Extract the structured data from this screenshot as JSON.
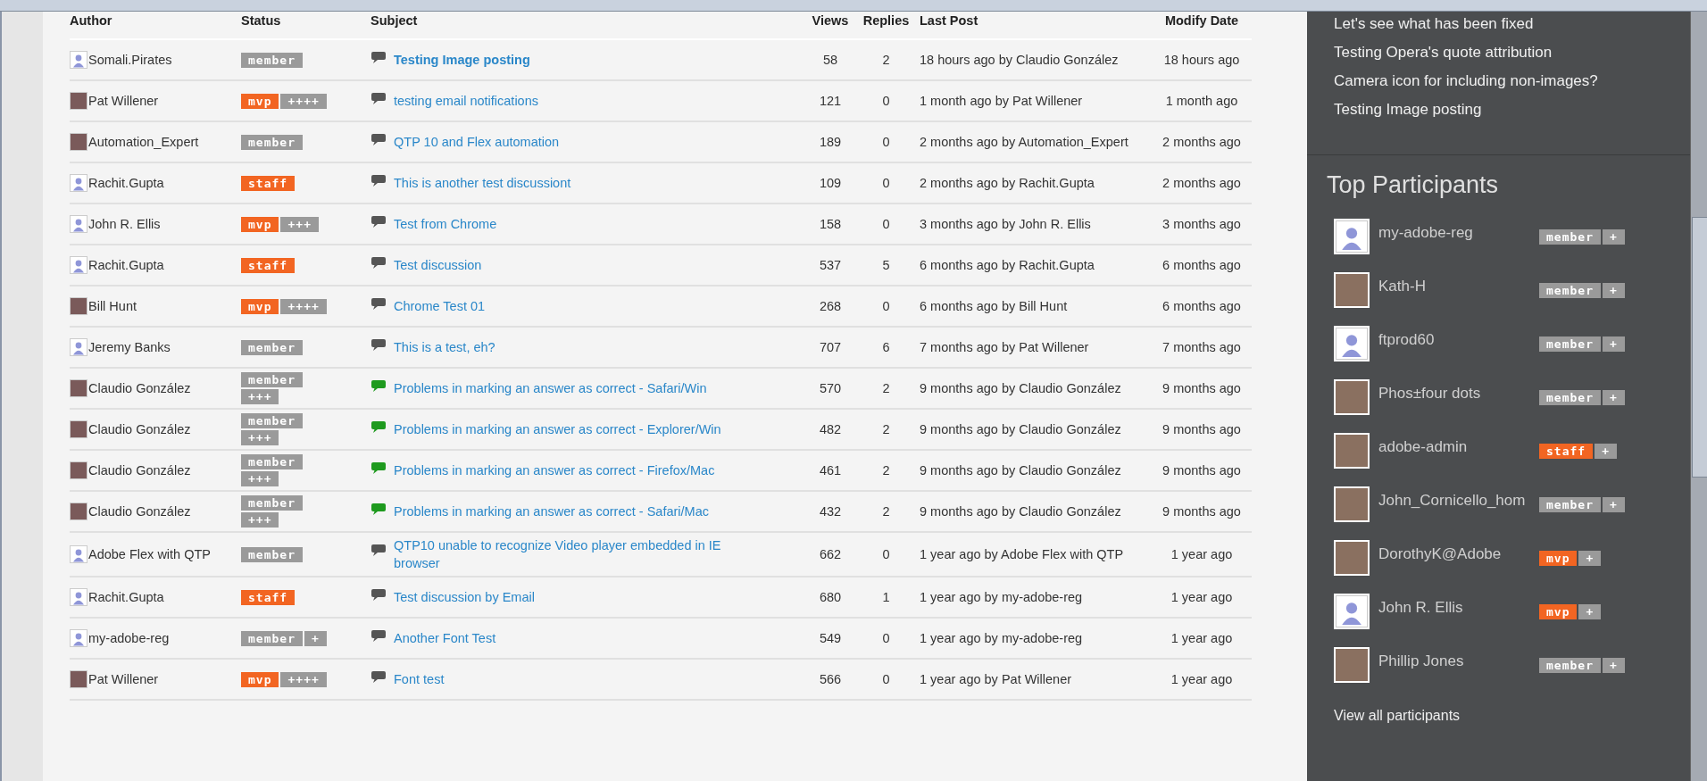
{
  "topics": {
    "columns": [
      "Author",
      "Status",
      "Subject",
      "Views",
      "Replies",
      "Last Post",
      "Modify Date"
    ],
    "rows": [
      {
        "author": "Somali.Pirates",
        "avatar": {
          "kind": "default"
        },
        "status": {
          "kind": "member",
          "label": "member"
        },
        "subject": "Testing Image posting",
        "unread": true,
        "answered": false,
        "views": "58",
        "replies": "2",
        "last_post": "18 hours ago by Claudio González",
        "modify_date": "18 hours ago"
      },
      {
        "author": "Pat Willener",
        "avatar": {
          "kind": "image"
        },
        "status": {
          "kind": "mvp",
          "label": "mvp",
          "plus": "++++"
        },
        "subject": "testing email notifications",
        "unread": false,
        "answered": false,
        "views": "121",
        "replies": "0",
        "last_post": "1 month ago by Pat Willener",
        "modify_date": "1 month ago"
      },
      {
        "author": "Automation_Expert",
        "avatar": {
          "kind": "image"
        },
        "status": {
          "kind": "member",
          "label": "member"
        },
        "subject": "QTP 10 and Flex automation",
        "unread": false,
        "answered": false,
        "views": "189",
        "replies": "0",
        "last_post": "2 months ago by Automation_Expert",
        "modify_date": "2 months ago"
      },
      {
        "author": "Rachit.Gupta",
        "avatar": {
          "kind": "default"
        },
        "status": {
          "kind": "staff",
          "label": "staff"
        },
        "subject": "This is another test discussiont",
        "unread": false,
        "answered": false,
        "views": "109",
        "replies": "0",
        "last_post": "2 months ago by Rachit.Gupta",
        "modify_date": "2 months ago"
      },
      {
        "author": "John R. Ellis",
        "avatar": {
          "kind": "default"
        },
        "status": {
          "kind": "mvp",
          "label": "mvp",
          "plus": "+++"
        },
        "subject": "Test from Chrome",
        "unread": false,
        "answered": false,
        "views": "158",
        "replies": "0",
        "last_post": "3 months ago by John R. Ellis",
        "modify_date": "3 months ago"
      },
      {
        "author": "Rachit.Gupta",
        "avatar": {
          "kind": "default"
        },
        "status": {
          "kind": "staff",
          "label": "staff"
        },
        "subject": "Test discussion",
        "unread": false,
        "answered": false,
        "views": "537",
        "replies": "5",
        "last_post": "6 months ago by Rachit.Gupta",
        "modify_date": "6 months ago"
      },
      {
        "author": "Bill Hunt",
        "avatar": {
          "kind": "image"
        },
        "status": {
          "kind": "mvp",
          "label": "mvp",
          "plus": "++++"
        },
        "subject": "Chrome Test 01",
        "unread": false,
        "answered": false,
        "views": "268",
        "replies": "0",
        "last_post": "6 months ago by Bill Hunt",
        "modify_date": "6 months ago"
      },
      {
        "author": "Jeremy Banks",
        "avatar": {
          "kind": "default"
        },
        "status": {
          "kind": "member",
          "label": "member"
        },
        "subject": "This is a test, eh?",
        "unread": false,
        "answered": false,
        "views": "707",
        "replies": "6",
        "last_post": "7 months ago by Pat Willener",
        "modify_date": "7 months ago"
      },
      {
        "author": "Claudio González",
        "avatar": {
          "kind": "image"
        },
        "status": {
          "kind": "member",
          "label": "member",
          "plus": "+++"
        },
        "subject": "Problems in marking an answer as correct - Safari/Win",
        "unread": false,
        "answered": true,
        "views": "570",
        "replies": "2",
        "last_post": "9 months ago by Claudio González",
        "modify_date": "9 months ago"
      },
      {
        "author": "Claudio González",
        "avatar": {
          "kind": "image"
        },
        "status": {
          "kind": "member",
          "label": "member",
          "plus": "+++"
        },
        "subject": "Problems in marking an answer as correct - Explorer/Win",
        "unread": false,
        "answered": true,
        "views": "482",
        "replies": "2",
        "last_post": "9 months ago by Claudio González",
        "modify_date": "9 months ago"
      },
      {
        "author": "Claudio González",
        "avatar": {
          "kind": "image"
        },
        "status": {
          "kind": "member",
          "label": "member",
          "plus": "+++"
        },
        "subject": "Problems in marking an answer as correct - Firefox/Mac",
        "unread": false,
        "answered": true,
        "views": "461",
        "replies": "2",
        "last_post": "9 months ago by Claudio González",
        "modify_date": "9 months ago"
      },
      {
        "author": "Claudio González",
        "avatar": {
          "kind": "image"
        },
        "status": {
          "kind": "member",
          "label": "member",
          "plus": "+++"
        },
        "subject": "Problems in marking an answer as correct - Safari/Mac",
        "unread": false,
        "answered": true,
        "views": "432",
        "replies": "2",
        "last_post": "9 months ago by Claudio González",
        "modify_date": "9 months ago"
      },
      {
        "author": "Adobe Flex with QTP",
        "avatar": {
          "kind": "default"
        },
        "status": {
          "kind": "member",
          "label": "member"
        },
        "subject": "QTP10 unable to recognize Video player embedded in IE browser",
        "unread": false,
        "answered": false,
        "views": "662",
        "replies": "0",
        "last_post": "1 year ago by Adobe Flex with QTP",
        "modify_date": "1 year ago"
      },
      {
        "author": "Rachit.Gupta",
        "avatar": {
          "kind": "default"
        },
        "status": {
          "kind": "staff",
          "label": "staff"
        },
        "subject": "Test discussion by Email",
        "unread": false,
        "answered": false,
        "views": "680",
        "replies": "1",
        "last_post": "1 year ago by my-adobe-reg",
        "modify_date": "1 year ago"
      },
      {
        "author": "my-adobe-reg",
        "avatar": {
          "kind": "default"
        },
        "status": {
          "kind": "member",
          "label": "member",
          "plus": "+"
        },
        "subject": "Another Font Test",
        "unread": false,
        "answered": false,
        "views": "549",
        "replies": "0",
        "last_post": "1 year ago by my-adobe-reg",
        "modify_date": "1 year ago"
      },
      {
        "author": "Pat Willener",
        "avatar": {
          "kind": "image"
        },
        "status": {
          "kind": "mvp",
          "label": "mvp",
          "plus": "++++"
        },
        "subject": "Font test",
        "unread": false,
        "answered": false,
        "views": "566",
        "replies": "0",
        "last_post": "1 year ago by Pat Willener",
        "modify_date": "1 year ago"
      }
    ]
  },
  "sidebar": {
    "recent_links": [
      "Let's see what has been fixed",
      "Testing Opera's quote attribution",
      "Camera icon for including non-images?",
      "Testing Image posting"
    ],
    "top_participants": {
      "title": "Top Participants",
      "items": [
        {
          "name": "my-adobe-reg",
          "avatar": {
            "kind": "default"
          },
          "badge": {
            "kind": "member",
            "label": "member",
            "plus": "+"
          }
        },
        {
          "name": "Kath-H",
          "avatar": {
            "kind": "image"
          },
          "badge": {
            "kind": "member",
            "label": "member",
            "plus": "+"
          }
        },
        {
          "name": "ftprod60",
          "avatar": {
            "kind": "default"
          },
          "badge": {
            "kind": "member",
            "label": "member",
            "plus": "+"
          }
        },
        {
          "name": "Phos±four dots",
          "avatar": {
            "kind": "image"
          },
          "badge": {
            "kind": "member",
            "label": "member",
            "plus": "+"
          }
        },
        {
          "name": "adobe-admin",
          "avatar": {
            "kind": "image"
          },
          "badge": {
            "kind": "staff",
            "label": "staff",
            "plus": "+"
          }
        },
        {
          "name": "John_Cornicello_hom",
          "avatar": {
            "kind": "image"
          },
          "badge": {
            "kind": "member",
            "label": "member",
            "plus": "+"
          }
        },
        {
          "name": "DorothyK@Adobe",
          "avatar": {
            "kind": "image"
          },
          "badge": {
            "kind": "mvp",
            "label": "mvp",
            "plus": "+"
          }
        },
        {
          "name": "John R. Ellis",
          "avatar": {
            "kind": "default"
          },
          "badge": {
            "kind": "mvp",
            "label": "mvp",
            "plus": "+"
          }
        },
        {
          "name": "Phillip Jones",
          "avatar": {
            "kind": "image"
          },
          "badge": {
            "kind": "member",
            "label": "member",
            "plus": "+"
          }
        }
      ],
      "view_all": "View all participants"
    }
  }
}
